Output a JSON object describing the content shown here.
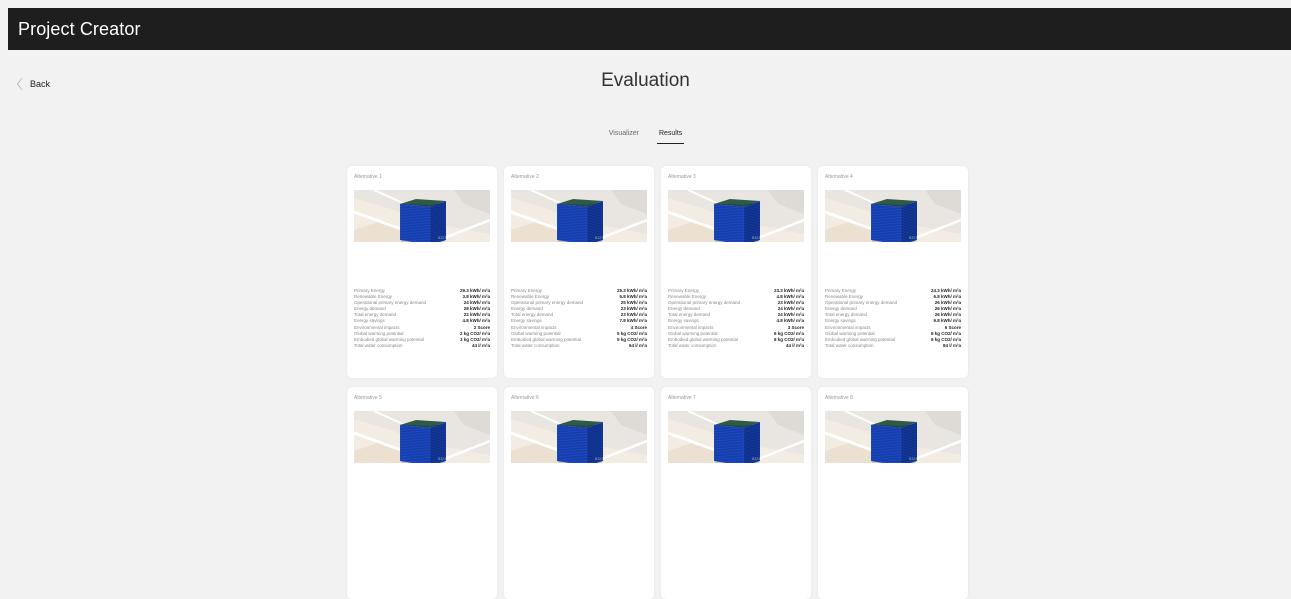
{
  "header": {
    "title": "Project Creator"
  },
  "nav": {
    "back_label": "Back"
  },
  "page": {
    "title": "Evaluation"
  },
  "tabs": [
    {
      "label": "Visualizer",
      "active": false
    },
    {
      "label": "Results",
      "active": true
    }
  ],
  "metric_labels": [
    "Primary Energy",
    "Renewable Energy",
    "Operational primary energy demand",
    "Energy demand",
    "Total energy demand",
    "Energy savings",
    "Environmental impacts",
    "Global warming potential",
    "Embodied global warming potential",
    "Total water consumption"
  ],
  "alternatives": [
    {
      "label": "Alternative 1",
      "values": [
        "29.3 kWh/ m²a",
        "3.8 kWh/ m²a",
        "24 kWh/ m²a",
        "28 kWh/ m²a",
        "22 kWh/ m²a",
        "4.8 kWh/ m²a",
        "2 Score",
        "2 kg CO2/ m²a",
        "3 kg CO2/ m²a",
        "44 l/ m²a"
      ]
    },
    {
      "label": "Alternative 2",
      "values": [
        "25.3 kWh/ m²a",
        "5.8 kWh/ m²a",
        "25 kWh/ m²a",
        "23 kWh/ m²a",
        "23 kWh/ m²a",
        "7.8 kWh/ m²a",
        "4 Score",
        "5 kg CO2/ m²a",
        "5 kg CO2/ m²a",
        "64 l/ m²a"
      ]
    },
    {
      "label": "Alternative 3",
      "values": [
        "23.3 kWh/ m²a",
        "4.8 kWh/ m²a",
        "23 kWh/ m²a",
        "24 kWh/ m²a",
        "24 kWh/ m²a",
        "4.8 kWh/ m²a",
        "3 Score",
        "6 kg CO2/ m²a",
        "8 kg CO2/ m²a",
        "44 l/ m²a"
      ]
    },
    {
      "label": "Alternative 4",
      "values": [
        "24.3 kWh/ m²a",
        "6.8 kWh/ m²a",
        "26 kWh/ m²a",
        "26 kWh/ m²a",
        "26 kWh/ m²a",
        "9.8 kWh/ m²a",
        "6 Score",
        "8 kg CO2/ m²a",
        "6 kg CO2/ m²a",
        "84 l/ m²a"
      ]
    },
    {
      "label": "Alternative 5",
      "values": []
    },
    {
      "label": "Alternative 6",
      "values": []
    },
    {
      "label": "Alternative 7",
      "values": []
    },
    {
      "label": "Alternative 8",
      "values": []
    }
  ],
  "map": {
    "street_label": "B323"
  },
  "colors": {
    "header_bg": "#1e1e1e",
    "page_bg": "#f2f2f2",
    "building_front": "#1f4fd0",
    "building_side": "#163da6",
    "building_roof": "#2f5a45"
  }
}
